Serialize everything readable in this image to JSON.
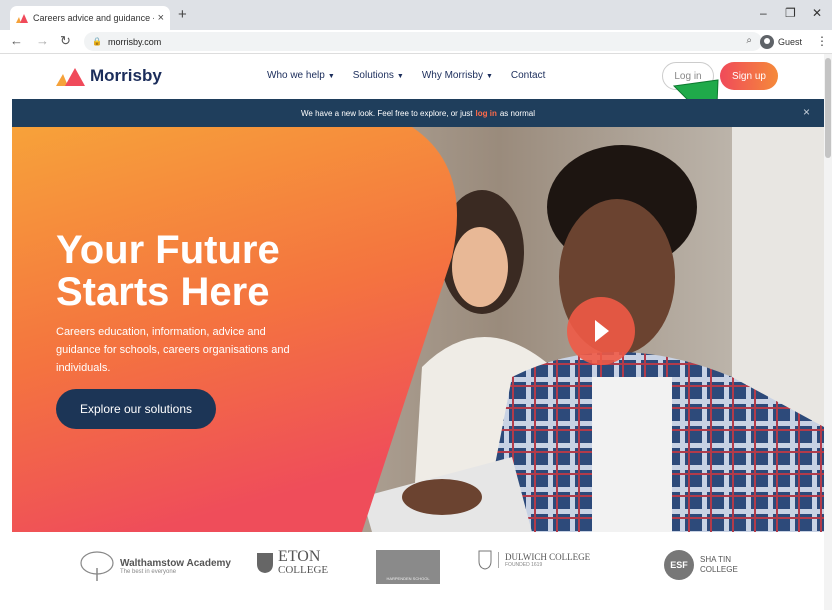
{
  "browser": {
    "tab_title": "Careers advice and guidance - M",
    "tab_close": "×",
    "new_tab": "+",
    "url": "morrisby.com",
    "profile_label": "Guest",
    "minimize": "–",
    "restore": "❐",
    "close": "✕"
  },
  "site": {
    "brand": "Morrisby",
    "nav": [
      {
        "label": "Who we help"
      },
      {
        "label": "Solutions"
      },
      {
        "label": "Why Morrisby"
      },
      {
        "label": "Contact"
      }
    ],
    "login_label": "Log in",
    "signup_label": "Sign up",
    "colors": {
      "navy": "#1b2d5b",
      "accent": "#f04a5a",
      "orange": "#f58a3a"
    }
  },
  "banner": {
    "text_before": "We have a new look. Feel free to explore, or just",
    "link": "log in",
    "text_after": "as normal",
    "close": "×"
  },
  "hero": {
    "title_line1": "Your Future",
    "title_line2": "Starts Here",
    "subtitle": "Careers education, information, advice and guidance for schools, careers organisations and individuals.",
    "cta_label": "Explore our solutions"
  },
  "partners": {
    "walthamstow": {
      "name": "Walthamstow Academy",
      "tagline": "The best in everyone"
    },
    "eton": {
      "name": "ETON",
      "sub": "COLLEGE"
    },
    "harpenden": {
      "name": "HARPENDEN SCHOOL"
    },
    "dulwich": {
      "name": "DULWICH COLLEGE",
      "sub": "FOUNDED 1619"
    },
    "shatin": {
      "badge": "ESF",
      "name1": "SHA TIN",
      "name2": "COLLEGE"
    }
  }
}
